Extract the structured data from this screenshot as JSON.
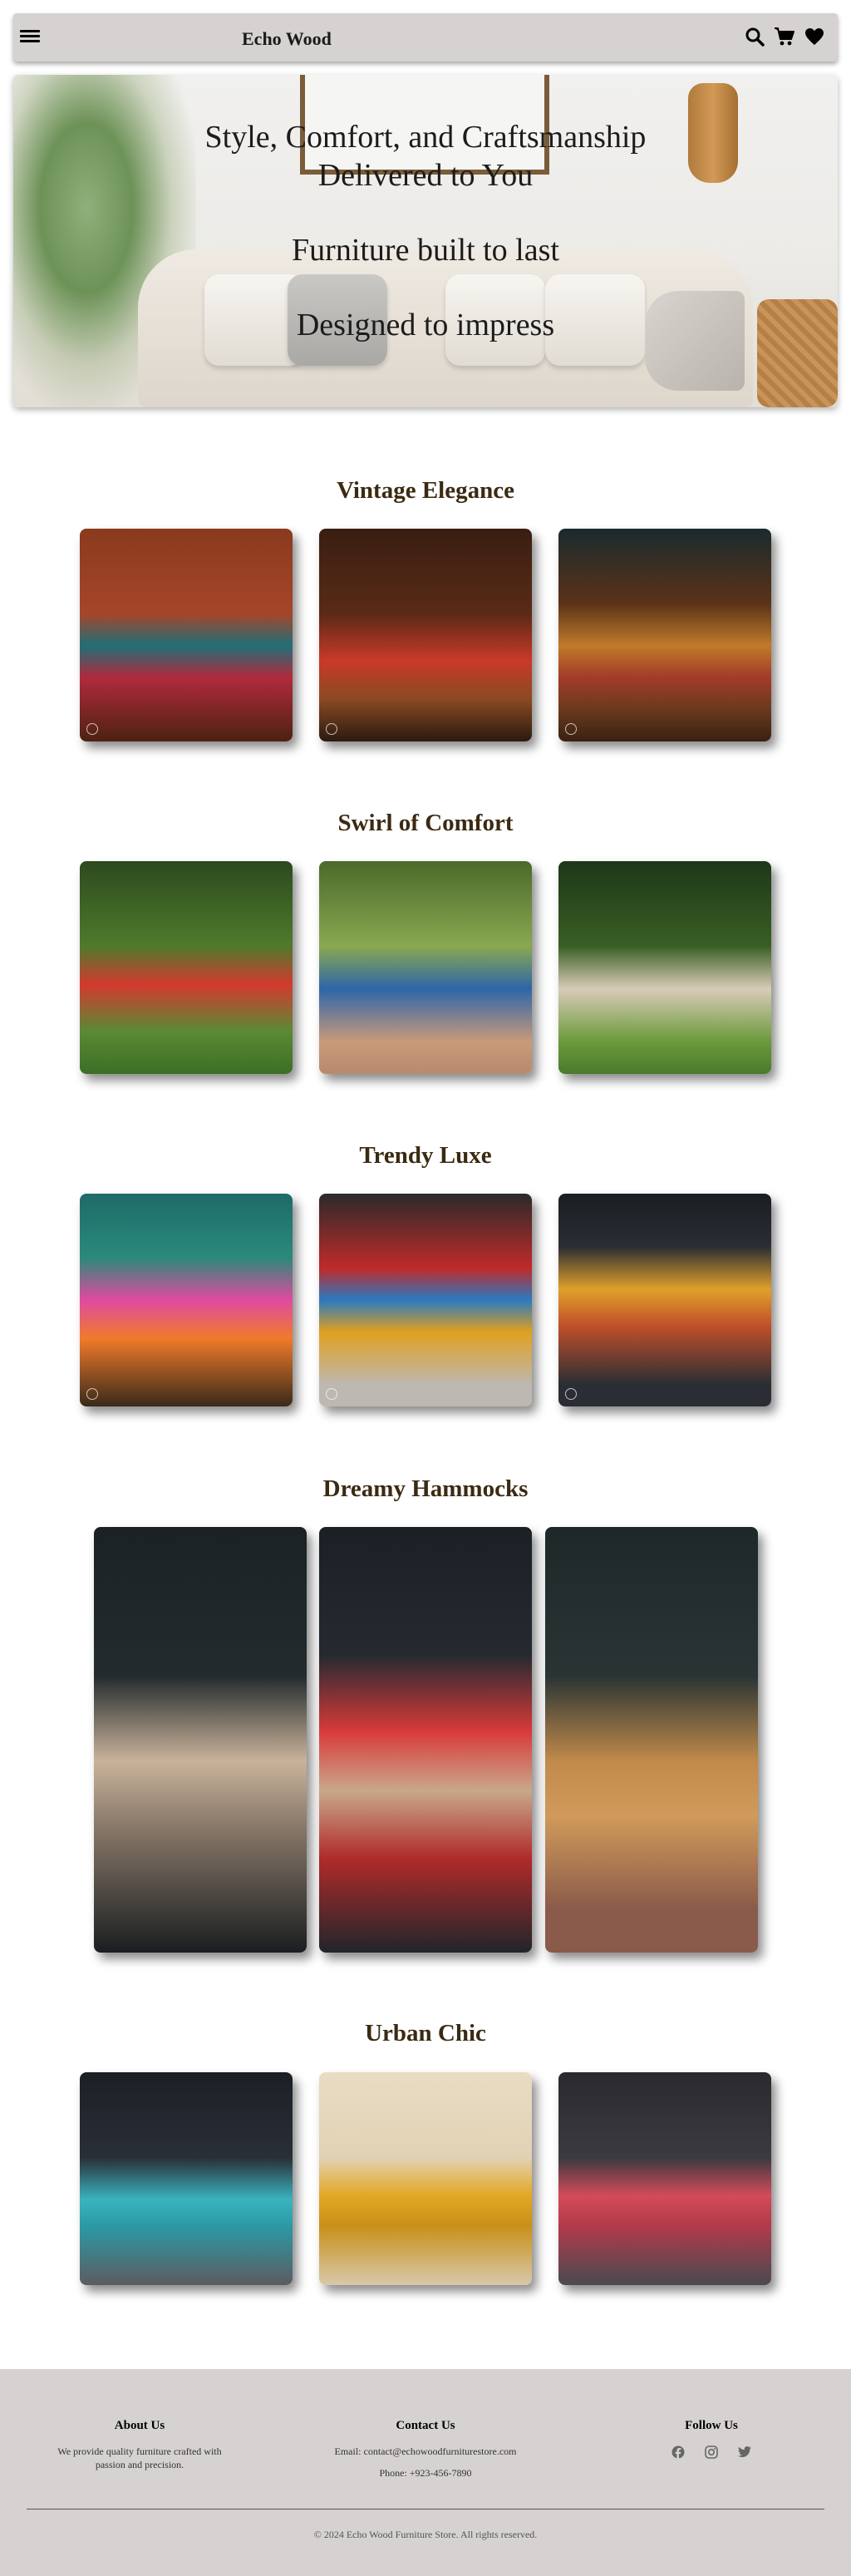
{
  "nav": {
    "brand": "Echo Wood",
    "icons": [
      "menu-icon",
      "search-icon",
      "cart-icon",
      "heart-icon"
    ]
  },
  "hero": {
    "line1": "Style, Comfort, and Craftsmanship",
    "line2": "Delivered to You",
    "line3": "Furniture built to last",
    "line4": "Designed to impress"
  },
  "sections": [
    {
      "title": "Vintage Elegance",
      "items": [
        "vintage-sofa-1",
        "vintage-sofa-2",
        "vintage-sofa-3"
      ]
    },
    {
      "title": "Swirl of Comfort",
      "items": [
        "swing-red",
        "swing-blue",
        "swing-cream"
      ]
    },
    {
      "title": "Trendy Luxe",
      "items": [
        "armchair-pink",
        "chair-round",
        "armchair-orange"
      ]
    },
    {
      "title": "Dreamy Hammocks",
      "items": [
        "hammock-cream",
        "hammock-red",
        "hammock-brown"
      ]
    },
    {
      "title": "Urban Chic",
      "items": [
        "sofa-teal",
        "chair-yellow",
        "sofa-red"
      ]
    }
  ],
  "footer": {
    "about_title": "About Us",
    "about_text_1": "We provide quality furniture crafted with",
    "about_text_2": "passion and precision.",
    "contact_title": "Contact Us",
    "email": "Email: contact@echowoodfurniturestore.com",
    "phone": "Phone: +923-456-7890",
    "follow_title": "Follow Us",
    "social": [
      "facebook-icon",
      "instagram-icon",
      "twitter-icon"
    ],
    "copyright": "© 2024 Echo Wood Furniture Store. All rights reserved."
  },
  "colors": {
    "nav_bg": "#d6d2d1",
    "section_title": "#3b2a12",
    "footer_bg": "#d6d2d1"
  }
}
